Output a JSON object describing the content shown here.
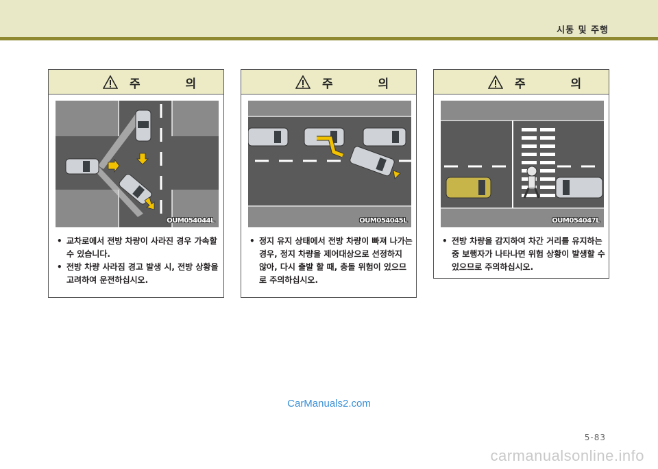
{
  "header": {
    "section_title": "시동 및 주행"
  },
  "cards": [
    {
      "title": "주 의",
      "figure_code": "OUM054044L",
      "bullets": [
        "교차로에서 전방 차량이 사라진 경우 가속할 수 있습니다.",
        "전방 차량 사라짐 경고 발생 시, 전방 상황을 고려하여 운전하십시오."
      ]
    },
    {
      "title": "주 의",
      "figure_code": "OUM054045L",
      "bullets": [
        "정지 유지 상태에서 전방 차량이 빠져 나가는 경우, 정지 차량을 제어대상으로 선정하지 않아, 다시 출발 할 때, 충돌 위험이 있으므로 주의하십시오."
      ]
    },
    {
      "title": "주 의",
      "figure_code": "OUM054047L",
      "bullets": [
        "전방 차량을 감지하여 차간 거리를 유지하는 중 보행자가 나타나면 위험 상황이 발생할 수 있으므로 주의하십시오."
      ]
    }
  ],
  "watermark": "CarManuals2.com",
  "page_number": "5-83",
  "footer_watermark": "carmanualsonline.info"
}
